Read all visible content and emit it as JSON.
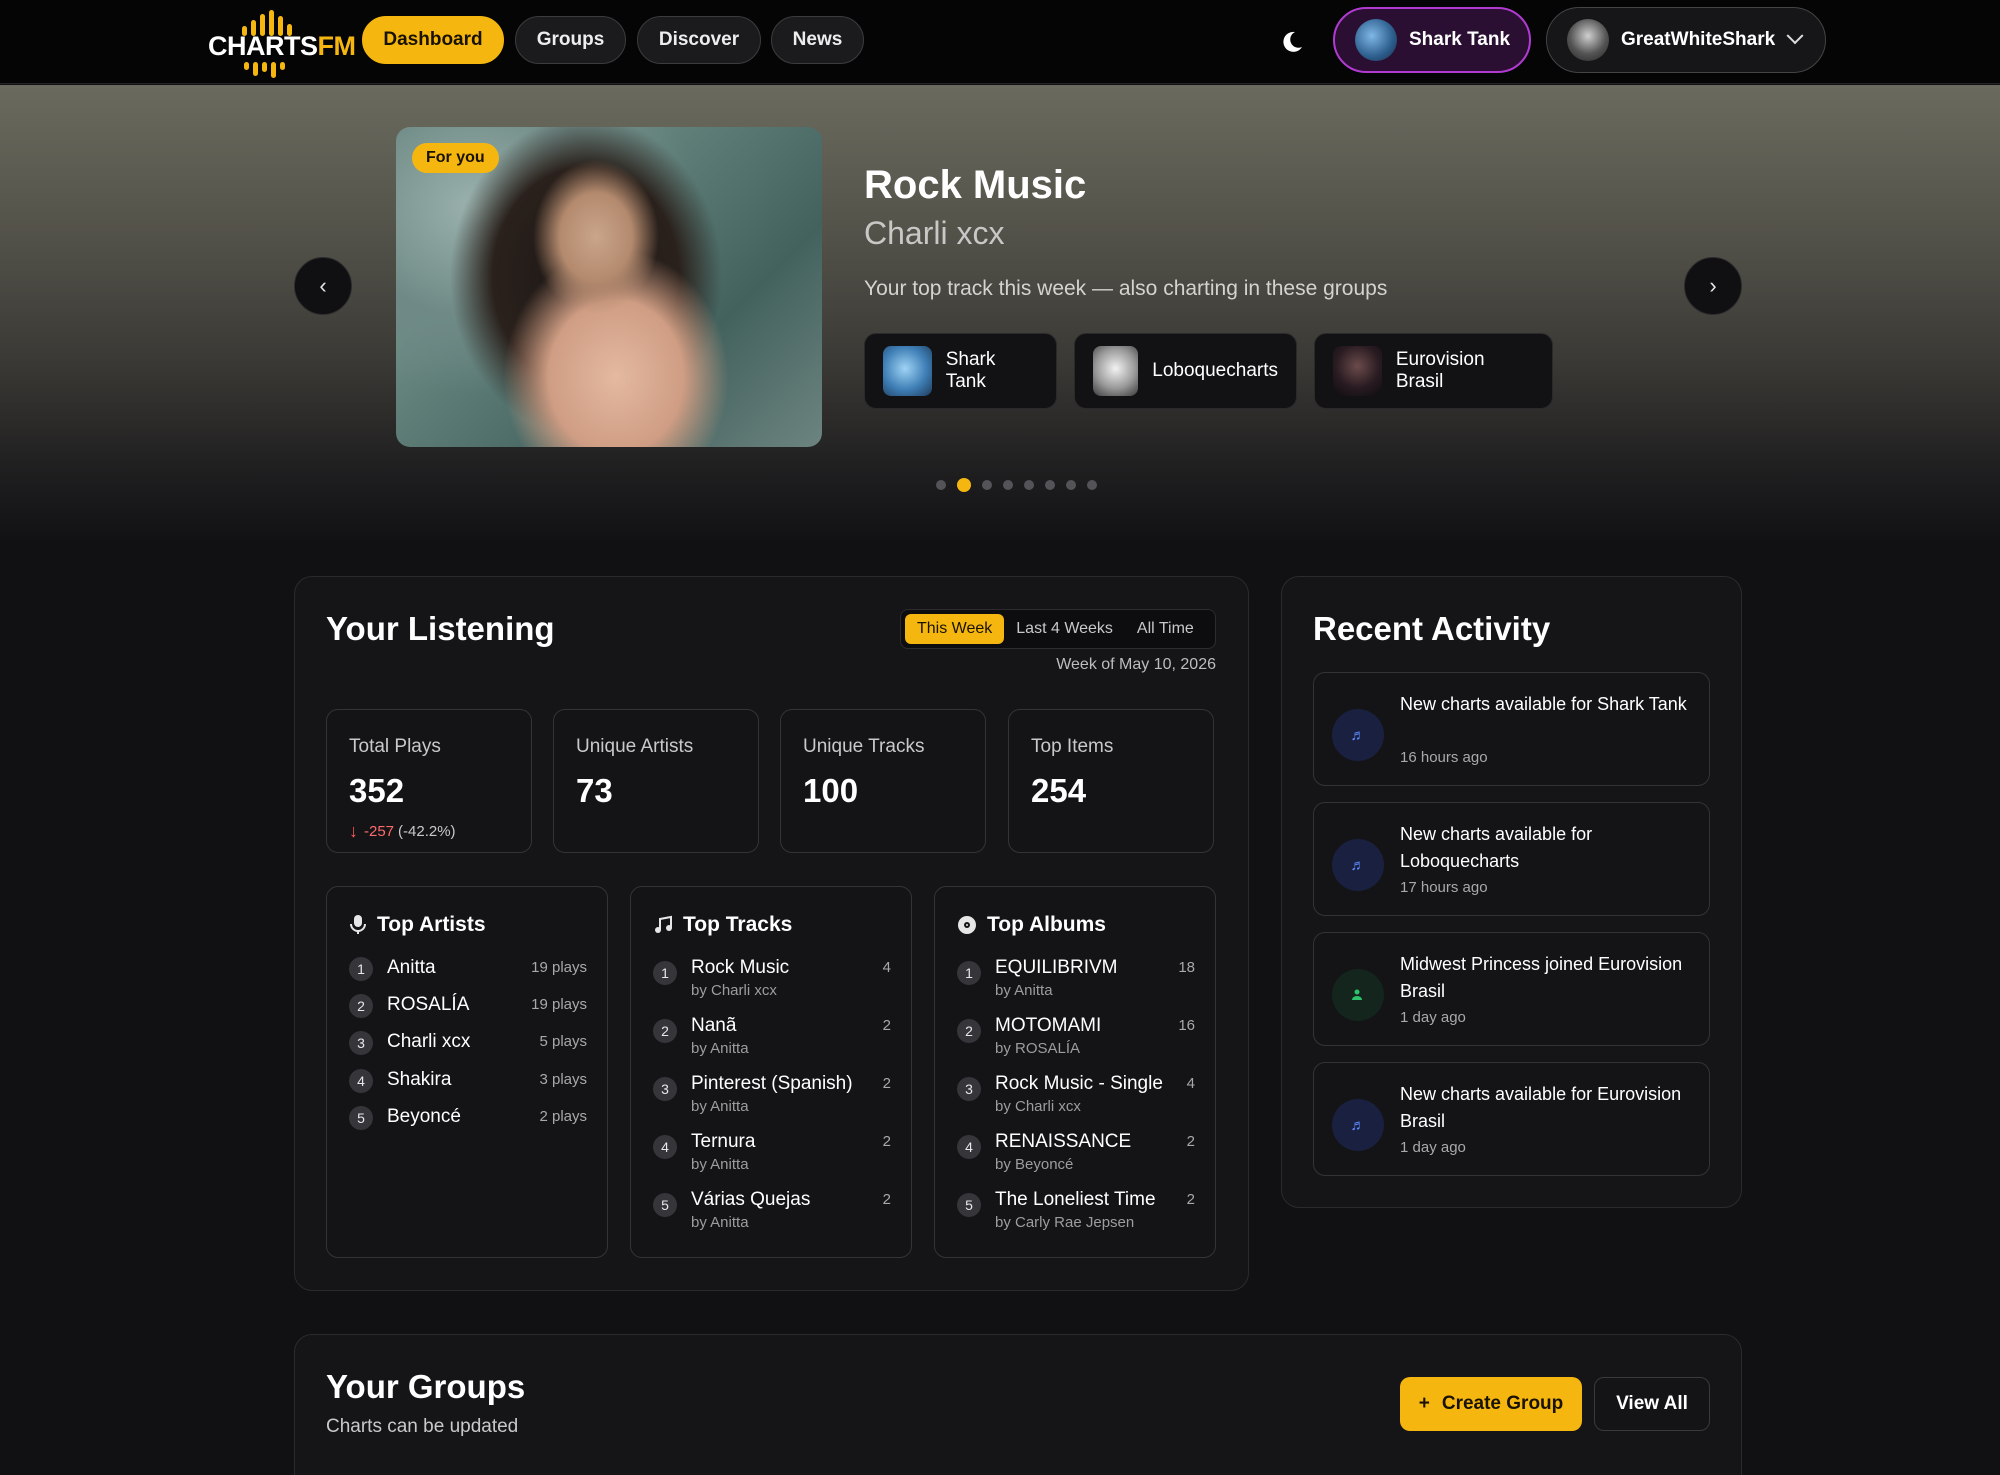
{
  "nav": {
    "logo_prefix": "CHARTS",
    "logo_suffix": "FM",
    "items": [
      {
        "label": "Dashboard",
        "active": true
      },
      {
        "label": "Groups",
        "active": false
      },
      {
        "label": "Discover",
        "active": false
      },
      {
        "label": "News",
        "active": false
      }
    ],
    "theme_icon": "moon-icon",
    "current_group": "Shark Tank",
    "username": "GreatWhiteShark"
  },
  "hero": {
    "badge": "For you",
    "title": "Rock Music",
    "artist": "Charli xcx",
    "description": "Your top track this week — also charting in these groups",
    "groups": [
      {
        "name": "Shark Tank"
      },
      {
        "name": "Loboquecharts"
      },
      {
        "name": "Eurovision Brasil"
      }
    ],
    "prev_label": "‹",
    "next_label": "›",
    "slide_count": 8,
    "active_slide": 2
  },
  "listening": {
    "title": "Your Listening",
    "ranges": [
      "This Week",
      "Last 4 Weeks",
      "All Time"
    ],
    "active_range": "This Week",
    "week_of": "Week of May 10, 2026",
    "stats": [
      {
        "label": "Total Plays",
        "value": "352",
        "change": "-257",
        "change_pct": "(-42.2%)"
      },
      {
        "label": "Unique Artists",
        "value": "73"
      },
      {
        "label": "Unique Tracks",
        "value": "100"
      },
      {
        "label": "Top Items",
        "value": "254"
      }
    ],
    "top_artists": {
      "title": "Top Artists",
      "items": [
        {
          "rank": "1",
          "name": "Anitta",
          "count": "19 plays"
        },
        {
          "rank": "2",
          "name": "ROSALÍA",
          "count": "19 plays"
        },
        {
          "rank": "3",
          "name": "Charli xcx",
          "count": "5 plays"
        },
        {
          "rank": "4",
          "name": "Shakira",
          "count": "3 plays"
        },
        {
          "rank": "5",
          "name": "Beyoncé",
          "count": "2 plays"
        }
      ]
    },
    "top_tracks": {
      "title": "Top Tracks",
      "items": [
        {
          "rank": "1",
          "name": "Rock Music",
          "by": "by Charli xcx",
          "count": "4"
        },
        {
          "rank": "2",
          "name": "Nanã",
          "by": "by Anitta",
          "count": "2"
        },
        {
          "rank": "3",
          "name": "Pinterest (Spanish)",
          "by": "by Anitta",
          "count": "2"
        },
        {
          "rank": "4",
          "name": "Ternura",
          "by": "by Anitta",
          "count": "2"
        },
        {
          "rank": "5",
          "name": "Várias Quejas",
          "by": "by Anitta",
          "count": "2"
        }
      ]
    },
    "top_albums": {
      "title": "Top Albums",
      "items": [
        {
          "rank": "1",
          "name": "EQUILIBRIVM",
          "by": "by Anitta",
          "count": "18"
        },
        {
          "rank": "2",
          "name": "MOTOMAMI",
          "by": "by ROSALÍA",
          "count": "16"
        },
        {
          "rank": "3",
          "name": "Rock Music - Single",
          "by": "by Charli xcx",
          "count": "4"
        },
        {
          "rank": "4",
          "name": "RENAISSANCE",
          "by": "by Beyoncé",
          "count": "2"
        },
        {
          "rank": "5",
          "name": "The Loneliest Time",
          "by": "by Carly Rae Jepsen",
          "count": "2"
        }
      ]
    }
  },
  "activity": {
    "title": "Recent Activity",
    "items": [
      {
        "text": "New charts available for Shark Tank",
        "time": "16 hours ago",
        "icon": "music-note-icon"
      },
      {
        "text": "New charts available for Loboquecharts",
        "time": "17 hours ago",
        "icon": "music-note-icon"
      },
      {
        "text": "Midwest Princess joined Eurovision Brasil",
        "time": "1 day ago",
        "icon": "user-joined-icon"
      },
      {
        "text": "New charts available for Eurovision Brasil",
        "time": "1 day ago",
        "icon": "music-note-icon"
      }
    ]
  },
  "groups": {
    "title": "Your Groups",
    "subtitle": "Charts can be updated",
    "create_label": "Create Group",
    "create_icon_glyph": "+",
    "view_all_label": "View All"
  },
  "colors": {
    "accent": "#f5b70f",
    "background": "#111013",
    "negative": "#ff6b6b",
    "group_border": "#b13ad0"
  }
}
